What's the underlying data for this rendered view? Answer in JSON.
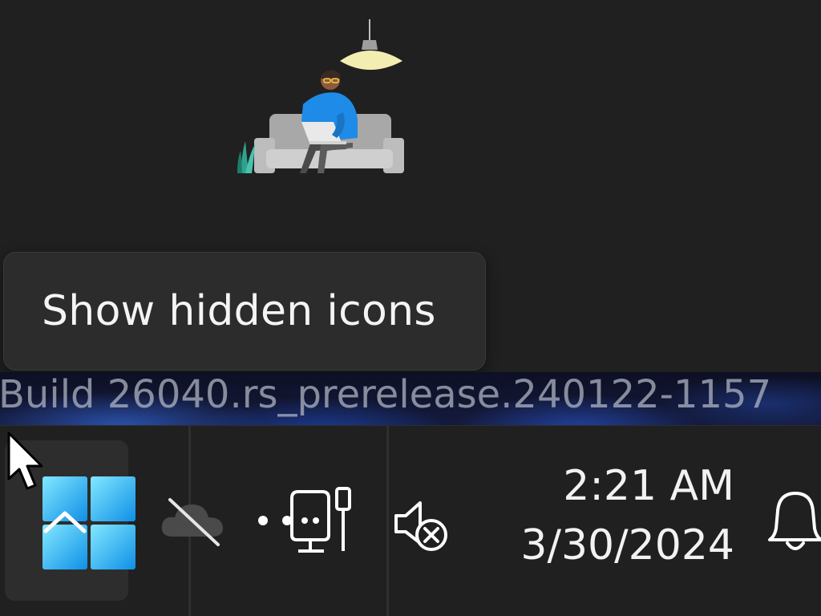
{
  "tooltip": {
    "text": "Show hidden icons"
  },
  "desktop": {
    "watermark": "Build 26040.rs_prerelease.240122-1157"
  },
  "taskbar": {
    "tray_overflow": {
      "icon": "chevron-up-icon"
    },
    "tray_icons": [
      {
        "name": "onedrive-offline-icon"
      },
      {
        "name": "network-ethernet-icon"
      },
      {
        "name": "volume-muted-icon"
      }
    ],
    "clock": {
      "time": "2:21 AM",
      "date": "3/30/2024"
    },
    "notifications": {
      "icon": "bell-icon"
    }
  },
  "colors": {
    "accent_blue": "#1f8be8",
    "logo_light": "#7fe3ff",
    "taskbar_bg": "#202020",
    "tooltip_bg": "#2c2c2c"
  }
}
